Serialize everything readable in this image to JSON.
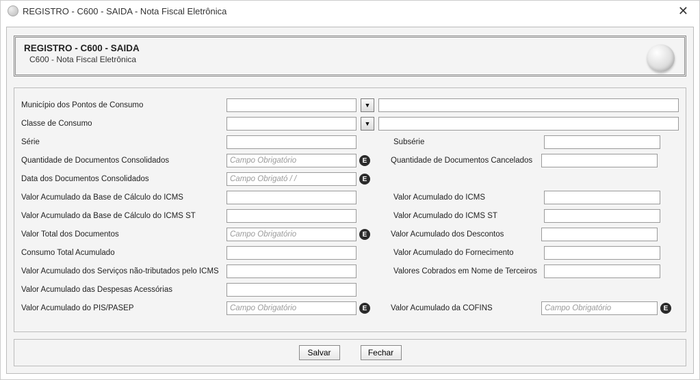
{
  "window": {
    "title": "REGISTRO - C600 - SAIDA - Nota Fiscal Eletrônica"
  },
  "header": {
    "title": "REGISTRO - C600 - SAIDA",
    "subtitle": "C600 - Nota Fiscal Eletrônica"
  },
  "labels": {
    "municipio": "Município dos Pontos de Consumo",
    "classe": "Classe de Consumo",
    "serie": "Série",
    "subserie": "Subsérie",
    "qtd_doc_consol": "Quantidade de Documentos Consolidados",
    "qtd_doc_cancel": "Quantidade de Documentos Cancelados",
    "data_doc_consol": "Data dos Documentos Consolidados",
    "vl_base_icms": "Valor Acumulado da Base de Cálculo do ICMS",
    "vl_icms": "Valor Acumulado do ICMS",
    "vl_base_icms_st": "Valor Acumulado da Base de Cálculo do ICMS ST",
    "vl_icms_st": "Valor Acumulado do ICMS ST",
    "vl_total_doc": "Valor Total dos Documentos",
    "vl_descontos": "Valor Acumulado dos Descontos",
    "consumo_total": "Consumo Total Acumulado",
    "vl_fornecimento": "Valor Acumulado do Fornecimento",
    "vl_serv_nt": "Valor Acumulado dos Serviços não-tributados pelo ICMS",
    "vl_terceiros": "Valores Cobrados em Nome de Terceiros",
    "vl_despesas": "Valor Acumulado das Despesas Acessórias",
    "vl_pis": "Valor Acumulado do PIS/PASEP",
    "vl_cofins": "Valor Acumulado da COFINS"
  },
  "placeholders": {
    "obrig": "Campo Obrigatório",
    "date_obrig": "Campo Obrigató / /"
  },
  "buttons": {
    "save": "Salvar",
    "close": "Fechar"
  },
  "badge": "E"
}
